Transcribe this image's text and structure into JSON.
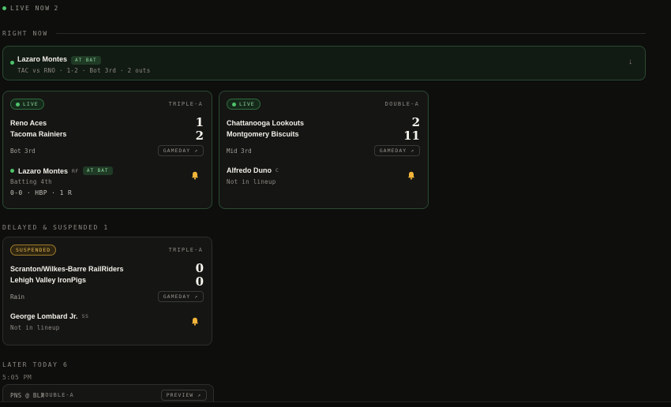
{
  "top_status": {
    "label": "LIVE NOW",
    "count": "2"
  },
  "sections": {
    "right_now": "RIGHT NOW",
    "delayed": "DELAYED & SUSPENDED 1",
    "later": "LATER TODAY 6",
    "later_time": "5:05 PM"
  },
  "banner": {
    "player": "Lazaro Montes",
    "badge": "AT BAT",
    "detail": "TAC vs RNO · 1-2 · Bot 3rd · 2 outs",
    "arrow": "↓"
  },
  "cards": [
    {
      "status": "LIVE",
      "level": "TRIPLE-A",
      "team1": "Reno Aces",
      "score1": "1",
      "team2": "Tacoma Rainiers",
      "score2": "2",
      "inning": "Bot 3rd",
      "gameday": "GAMEDAY ↗",
      "player": "Lazaro Montes",
      "pos": "RF",
      "badge": "AT BAT",
      "sub": "Batting 4th",
      "line": "0-0 · HBP · 1 R"
    },
    {
      "status": "LIVE",
      "level": "DOUBLE-A",
      "team1": "Chattanooga Lookouts",
      "score1": "2",
      "team2": "Montgomery Biscuits",
      "score2": "11",
      "inning": "Mid 3rd",
      "gameday": "GAMEDAY ↗",
      "player": "Alfredo Duno",
      "pos": "C",
      "sub": "Not in lineup"
    },
    {
      "status": "SUSPENDED",
      "level": "TRIPLE-A",
      "team1": "Scranton/Wilkes-Barre RailRiders",
      "score1": "0",
      "team2": "Lehigh Valley IronPigs",
      "score2": "0",
      "inning": "Rain",
      "gameday": "GAMEDAY ↗",
      "player": "George Lombard Jr.",
      "pos": "SS",
      "sub": "Not in lineup"
    }
  ],
  "preview": {
    "matchup": "PNS @ BLX",
    "level": "DOUBLE-A",
    "button": "PREVIEW ↗"
  },
  "colors": {
    "live_green": "#4ec36a",
    "suspended_amber": "#e6b84f",
    "bell": "#f2b53a"
  }
}
